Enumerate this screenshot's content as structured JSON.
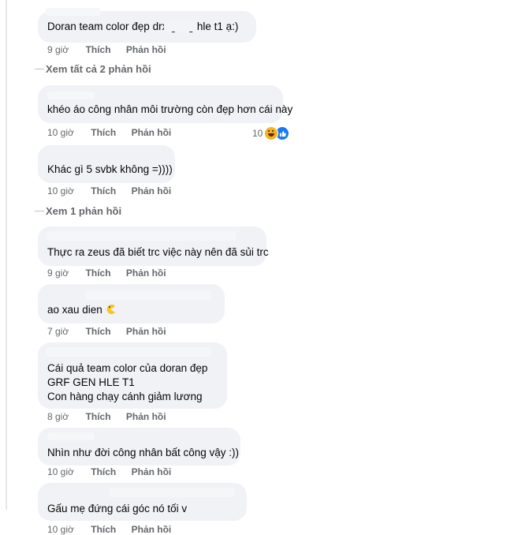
{
  "comments": [
    {
      "lines": [
        "Doran team color đẹp    drx geng hle t1 ạ:)"
      ],
      "time": "9 giờ"
    },
    {
      "lines": [
        "khéo áo công nhân môi trường còn đẹp hơn cái này"
      ],
      "time": "10 giờ",
      "reaction_count": "10"
    },
    {
      "lines": [
        "Khác gì 5 svbk không =))))"
      ],
      "time": "10 giờ"
    },
    {
      "lines": [
        "Thực ra zeus đã biết trc việc này nên đã sủi trc"
      ],
      "time": "9 giờ"
    },
    {
      "lines": [
        "ao xau dien"
      ],
      "time": "7 giờ"
    },
    {
      "lines": [
        "Cái quả team color của doran đẹp",
        "GRF GEN HLE T1",
        "Con hàng chạy cánh giảm lương"
      ],
      "time": "8 giờ"
    },
    {
      "lines": [
        "Nhìn như đời công nhân bất công vậy :))"
      ],
      "time": "10 giờ"
    },
    {
      "lines": [
        "Gấu mẹ đứng cái góc nó tối v"
      ],
      "time": "10 giờ"
    }
  ],
  "actions": {
    "like": "Thích",
    "reply": "Phản hồi"
  },
  "view_replies": [
    "Xem tất cả 2 phản hồi",
    "Xem 1 phản hồi"
  ],
  "icons": {
    "reaction_haha": "haha-emoji-icon",
    "reaction_like": "like-icon",
    "emoji_inline": "pacman-emoji-icon"
  },
  "colors": {
    "bubble": "#f0f2f5",
    "meta": "#65676b",
    "like_blue": "#1877f2"
  }
}
